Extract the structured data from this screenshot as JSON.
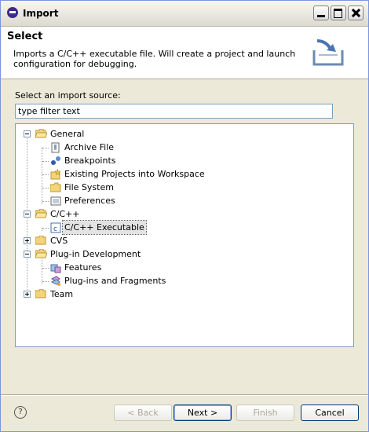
{
  "window": {
    "title": "Import"
  },
  "header": {
    "title": "Select",
    "description": "Imports a C/C++ executable file. Will create a project and launch configuration for debugging."
  },
  "source": {
    "label": "Select an import source:",
    "filter_value": "type filter text"
  },
  "tree": {
    "general": "General",
    "archive_file": "Archive File",
    "breakpoints": "Breakpoints",
    "existing_projects": "Existing Projects into Workspace",
    "file_system": "File System",
    "preferences": "Preferences",
    "cpp": "C/C++",
    "cpp_executable": "C/C++ Executable",
    "cvs": "CVS",
    "plugin_development": "Plug-in Development",
    "features": "Features",
    "plugins_fragments": "Plug-ins and Fragments",
    "team": "Team",
    "selected": "C/C++ Executable"
  },
  "footer": {
    "help": "?",
    "back": "< Back",
    "next": "Next >",
    "finish": "Finish",
    "cancel": "Cancel"
  },
  "colors": {
    "folder": "#f5d37a",
    "selection": "#e3e3e3",
    "accent": "#3d2a8c"
  }
}
